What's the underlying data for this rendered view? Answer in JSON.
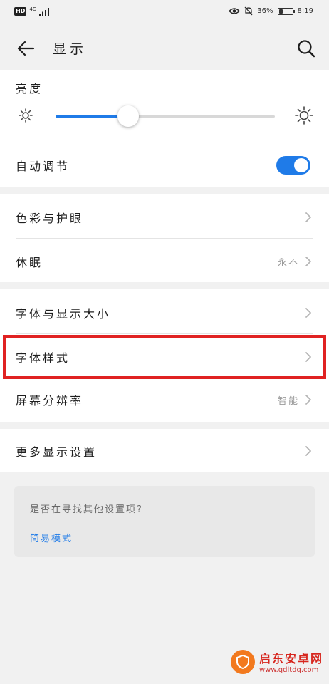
{
  "status_bar": {
    "hd_badge": "HD",
    "network_label": "4G",
    "battery_percent_label": "36%",
    "battery_level": 0.36,
    "time": "8:19"
  },
  "app_bar": {
    "title": "显示",
    "back_icon": "back-arrow-icon",
    "search_icon": "search-icon"
  },
  "brightness": {
    "label": "亮度",
    "level": 0.33,
    "auto_adjust_label": "自动调节",
    "auto_adjust_on": true
  },
  "section1": {
    "items": [
      {
        "label": "色彩与护眼",
        "value": ""
      },
      {
        "label": "休眠",
        "value": "永不"
      }
    ]
  },
  "section2": {
    "items": [
      {
        "label": "字体与显示大小",
        "value": ""
      },
      {
        "label": "字体样式",
        "value": ""
      },
      {
        "label": "屏幕分辨率",
        "value": "智能"
      }
    ]
  },
  "section3": {
    "items": [
      {
        "label": "更多显示设置",
        "value": ""
      }
    ]
  },
  "tip_card": {
    "question": "是否在寻找其他设置项?",
    "link": "简易模式"
  },
  "watermark": {
    "name": "启东安卓网",
    "url": "www.qdltdq.com"
  },
  "colors": {
    "accent": "#1f7be8",
    "highlight": "#e02222",
    "background": "#f1f1f1"
  }
}
